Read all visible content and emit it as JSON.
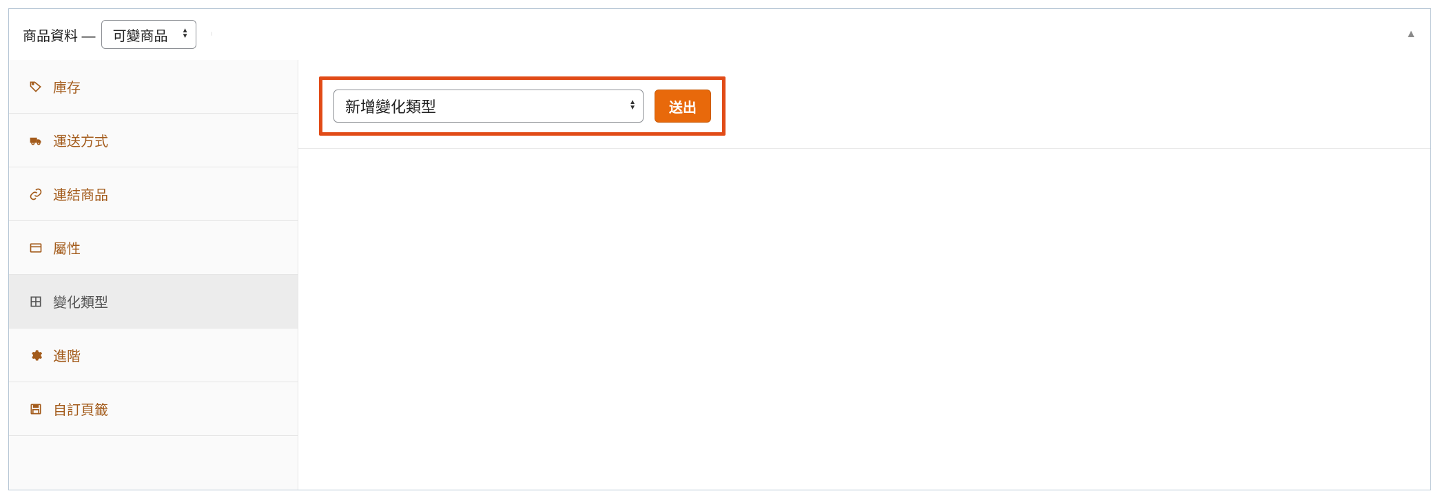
{
  "header": {
    "title": "商品資料 —",
    "product_type_selected": "可變商品"
  },
  "sidebar": {
    "items": [
      {
        "label": "庫存"
      },
      {
        "label": "運送方式"
      },
      {
        "label": "連結商品"
      },
      {
        "label": "屬性"
      },
      {
        "label": "變化類型"
      },
      {
        "label": "進階"
      },
      {
        "label": "自訂頁籤"
      }
    ]
  },
  "content": {
    "variation_action_selected": "新增變化類型",
    "submit_label": "送出"
  }
}
